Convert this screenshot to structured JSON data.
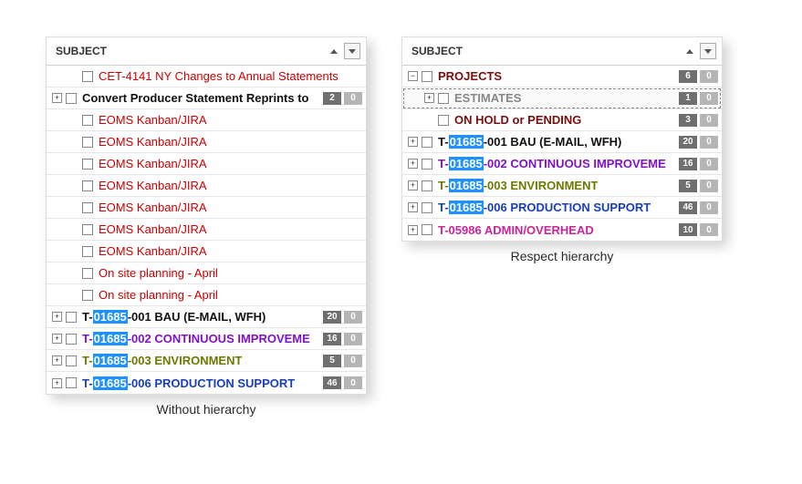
{
  "left": {
    "header": "SUBJECT",
    "caption": "Without hierarchy",
    "rows": [
      {
        "indent": 2,
        "expander": "",
        "prefix": "",
        "text": "CET-4141  NY Changes to Annual Statements",
        "color": "red",
        "bold": false,
        "badges": [],
        "selected": false
      },
      {
        "indent": 1,
        "expander": "plus",
        "prefix": "",
        "text": "Convert Producer Statement Reprints to",
        "color": "black",
        "bold": true,
        "badges": [
          "2",
          "0"
        ],
        "selected": false
      },
      {
        "indent": 2,
        "expander": "",
        "prefix": "",
        "text": "EOMS Kanban/JIRA",
        "color": "red",
        "bold": false,
        "badges": [],
        "selected": false
      },
      {
        "indent": 2,
        "expander": "",
        "prefix": "",
        "text": "EOMS Kanban/JIRA",
        "color": "red",
        "bold": false,
        "badges": [],
        "selected": false
      },
      {
        "indent": 2,
        "expander": "",
        "prefix": "",
        "text": "EOMS Kanban/JIRA",
        "color": "red",
        "bold": false,
        "badges": [],
        "selected": false
      },
      {
        "indent": 2,
        "expander": "",
        "prefix": "",
        "text": "EOMS Kanban/JIRA",
        "color": "red",
        "bold": false,
        "badges": [],
        "selected": false
      },
      {
        "indent": 2,
        "expander": "",
        "prefix": "",
        "text": "EOMS Kanban/JIRA",
        "color": "red",
        "bold": false,
        "badges": [],
        "selected": false
      },
      {
        "indent": 2,
        "expander": "",
        "prefix": "",
        "text": "EOMS Kanban/JIRA",
        "color": "red",
        "bold": false,
        "badges": [],
        "selected": false
      },
      {
        "indent": 2,
        "expander": "",
        "prefix": "",
        "text": "EOMS Kanban/JIRA",
        "color": "red",
        "bold": false,
        "badges": [],
        "selected": false
      },
      {
        "indent": 2,
        "expander": "",
        "prefix": "",
        "text": "On site planning - April",
        "color": "red",
        "bold": false,
        "badges": [],
        "selected": false
      },
      {
        "indent": 2,
        "expander": "",
        "prefix": "",
        "text": "On site planning - April",
        "color": "red",
        "bold": false,
        "badges": [],
        "selected": false
      },
      {
        "indent": 1,
        "expander": "plus",
        "prefix": "T-",
        "hl": "01685",
        "text": "-001 BAU (E-MAIL, WFH)",
        "color": "black",
        "bold": true,
        "badges": [
          "20",
          "0"
        ],
        "selected": false
      },
      {
        "indent": 1,
        "expander": "plus",
        "prefix": "T-",
        "hl": "01685",
        "text": "-002 CONTINUOUS IMPROVEME",
        "color": "purple",
        "bold": true,
        "badges": [
          "16",
          "0"
        ],
        "selected": false
      },
      {
        "indent": 1,
        "expander": "plus",
        "prefix": "T-",
        "hl": "01685",
        "text": "-003 ENVIRONMENT",
        "color": "olive",
        "bold": true,
        "badges": [
          "5",
          "0"
        ],
        "selected": false
      },
      {
        "indent": 1,
        "expander": "plus",
        "prefix": "T-",
        "hl": "01685",
        "text": "-006 PRODUCTION SUPPORT",
        "color": "blue",
        "bold": true,
        "badges": [
          "46",
          "0"
        ],
        "selected": false
      }
    ]
  },
  "right": {
    "header": "SUBJECT",
    "caption": "Respect hierarchy",
    "rows": [
      {
        "indent": 1,
        "expander": "minus",
        "prefix": "",
        "text": "PROJECTS",
        "color": "brown",
        "bold": true,
        "badges": [
          "6",
          "0"
        ],
        "selected": false
      },
      {
        "indent": 2,
        "expander": "plus",
        "prefix": "",
        "text": "ESTIMATES",
        "color": "gray",
        "bold": true,
        "badges": [
          "1",
          "0"
        ],
        "selected": true
      },
      {
        "indent": 2,
        "expander": "",
        "prefix": "",
        "text": "ON HOLD or PENDING",
        "color": "brown",
        "bold": true,
        "badges": [
          "3",
          "0"
        ],
        "selected": false
      },
      {
        "indent": 1,
        "expander": "plus",
        "prefix": "T-",
        "hl": "01685",
        "text": "-001 BAU (E-MAIL, WFH)",
        "color": "black",
        "bold": true,
        "badges": [
          "20",
          "0"
        ],
        "selected": false
      },
      {
        "indent": 1,
        "expander": "plus",
        "prefix": "T-",
        "hl": "01685",
        "text": "-002 CONTINUOUS IMPROVEME",
        "color": "purple",
        "bold": true,
        "badges": [
          "16",
          "0"
        ],
        "selected": false
      },
      {
        "indent": 1,
        "expander": "plus",
        "prefix": "T-",
        "hl": "01685",
        "text": "-003 ENVIRONMENT",
        "color": "olive",
        "bold": true,
        "badges": [
          "5",
          "0"
        ],
        "selected": false
      },
      {
        "indent": 1,
        "expander": "plus",
        "prefix": "T-",
        "hl": "01685",
        "text": "-006 PRODUCTION SUPPORT",
        "color": "blue",
        "bold": true,
        "badges": [
          "46",
          "0"
        ],
        "selected": false
      },
      {
        "indent": 1,
        "expander": "plus",
        "prefix": "",
        "text": "T-05986 ADMIN/OVERHEAD",
        "color": "pink",
        "bold": true,
        "badges": [
          "10",
          "0"
        ],
        "selected": false
      }
    ]
  }
}
